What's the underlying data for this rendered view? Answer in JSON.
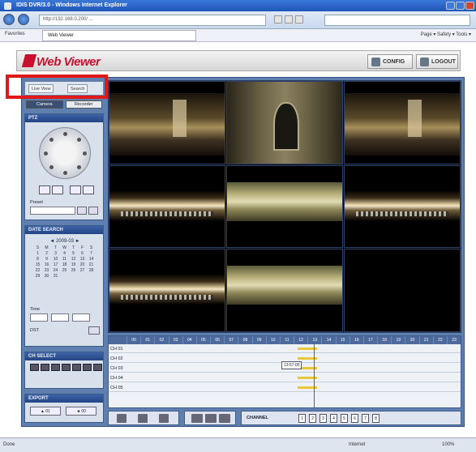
{
  "browser": {
    "title": "IDIS DVR/3.0 - Windows Internet Explorer",
    "address": "http://192.168.0.200/ ...",
    "favorites_label": "Favorites",
    "tab_label": "Web Viewer",
    "commands": "Page ▾  Safety ▾  Tools ▾",
    "status_left": "Done",
    "status_zone": "Internet",
    "status_zoom": "100%"
  },
  "app": {
    "logo_text": "Web Viewer",
    "config_label": "CONFIG",
    "logout_label": "LOGOUT",
    "mode_toggle": {
      "live": "Live View",
      "search": "Search"
    },
    "tabs": [
      "Camera",
      "Recorder"
    ],
    "panels": {
      "ptz": "PTZ",
      "preset": "Preset",
      "search": "DATE SEARCH",
      "ch_select": "CH SELECT",
      "export": "EXPORT"
    },
    "calendar": {
      "title": "◄ 2009-03 ►",
      "days": [
        "S",
        "M",
        "T",
        "W",
        "T",
        "F",
        "S",
        "1",
        "2",
        "3",
        "4",
        "5",
        "6",
        "7",
        "8",
        "9",
        "10",
        "11",
        "12",
        "13",
        "14",
        "15",
        "16",
        "17",
        "18",
        "19",
        "20",
        "21",
        "22",
        "23",
        "24",
        "25",
        "26",
        "27",
        "28",
        "29",
        "30",
        "31",
        "",
        "",
        "",
        ""
      ]
    },
    "time_label": "Time",
    "dst_label": "DST",
    "bottom_btns": [
      "▲ 01",
      "◄ 00"
    ],
    "timeline": {
      "hours": [
        "00",
        "01",
        "02",
        "03",
        "04",
        "05",
        "06",
        "07",
        "08",
        "09",
        "10",
        "11",
        "12",
        "13",
        "14",
        "15",
        "16",
        "17",
        "18",
        "19",
        "20",
        "21",
        "22",
        "23"
      ],
      "channels": [
        "CH 01",
        "CH 02",
        "CH 03",
        "CH 04",
        "CH 05"
      ],
      "tooltip": "13:57:00"
    },
    "channel_label": "CHANNEL",
    "channel_buttons": [
      "1",
      "2",
      "3",
      "4",
      "5",
      "6",
      "7",
      "8"
    ]
  }
}
